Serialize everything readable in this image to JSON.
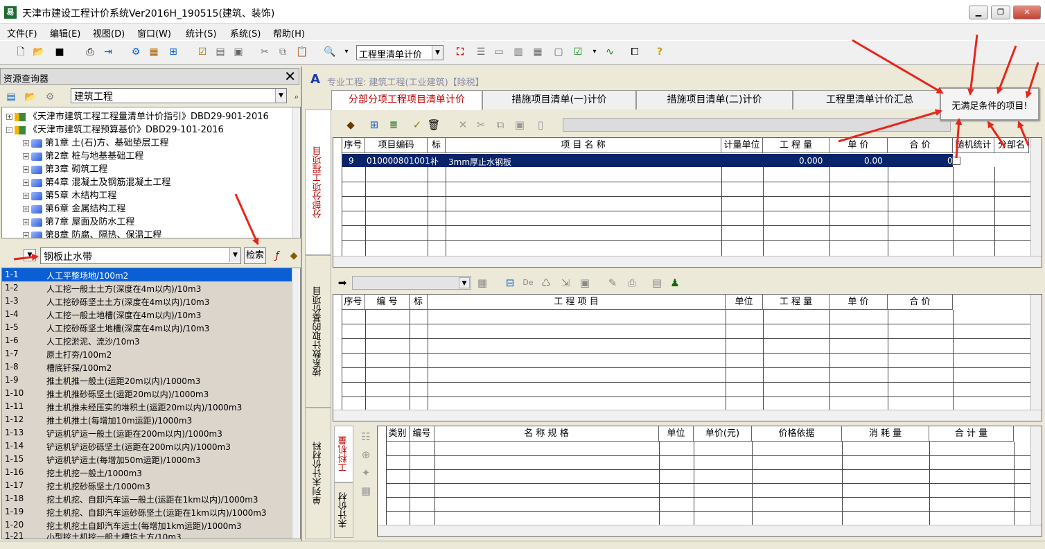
{
  "window": {
    "title": "天津市建设工程计价系统Ver2016H_190515(建筑、装饰)",
    "icon": "app-icon",
    "controls": [
      "minimize-icon",
      "restore-icon",
      "close-icon"
    ]
  },
  "menu": [
    "文件(F)",
    "编辑(E)",
    "视图(D)",
    "窗口(W)",
    "统计(S)",
    "系统(S)",
    "帮助(H)"
  ],
  "toolbar": {
    "view_select": "工程里清单计价",
    "icons": [
      "new-icon",
      "open-icon",
      "save-icon",
      "print-icon",
      "exit-icon",
      "calc-icon",
      "report-icon",
      "tree-icon",
      "check-icon",
      "template-icon",
      "export-icon",
      "cut-icon",
      "copy-icon",
      "paste-icon",
      "find-icon",
      "select-all-icon",
      "list-icon",
      "window-icon",
      "layout-icon",
      "chart-icon",
      "grid-icon",
      "help-icon"
    ]
  },
  "left_panel": {
    "title": "资源查询器",
    "library": "建筑工程",
    "tree": [
      {
        "label": "《天津市建筑工程工程量清单计价指引》DBD29-901-2016",
        "level": 0,
        "expand": "+",
        "icon": "book-icon"
      },
      {
        "label": "《天津市建筑工程预算基价》DBD29-101-2016",
        "level": 0,
        "expand": "-",
        "icon": "book-icon"
      },
      {
        "label": "第1章   土(石)方、基础垫层工程",
        "level": 1,
        "expand": "+",
        "icon": "chapter-icon"
      },
      {
        "label": "第2章   桩与地基基础工程",
        "level": 1,
        "expand": "+",
        "icon": "chapter-icon"
      },
      {
        "label": "第3章   砌筑工程",
        "level": 1,
        "expand": "+",
        "icon": "chapter-icon"
      },
      {
        "label": "第4章   混凝土及钢筋混凝土工程",
        "level": 1,
        "expand": "+",
        "icon": "chapter-icon"
      },
      {
        "label": "第5章   木结构工程",
        "level": 1,
        "expand": "+",
        "icon": "chapter-icon"
      },
      {
        "label": "第6章   金属结构工程",
        "level": 1,
        "expand": "+",
        "icon": "chapter-icon"
      },
      {
        "label": "第7章   屋面及防水工程",
        "level": 1,
        "expand": "+",
        "icon": "chapter-icon"
      },
      {
        "label": "第8章   防腐、隔热、保温工程",
        "level": 1,
        "expand": "+",
        "icon": "chapter-icon"
      }
    ],
    "search_value": "钢板止水带",
    "search_button": "检索",
    "quota_items": [
      {
        "code": "1-1",
        "name": "人工平整场地/100m2"
      },
      {
        "code": "1-2",
        "name": "人工挖一般土土方(深度在4m以内)/10m3"
      },
      {
        "code": "1-3",
        "name": "人工挖砂砾坚土土方(深度在4m以内)/10m3"
      },
      {
        "code": "1-4",
        "name": "人工挖一般土地槽(深度在4m以内)/10m3"
      },
      {
        "code": "1-5",
        "name": "人工挖砂砾坚土地槽(深度在4m以内)/10m3"
      },
      {
        "code": "1-6",
        "name": "人工挖淤泥、流沙/10m3"
      },
      {
        "code": "1-7",
        "name": "原土打夯/100m2"
      },
      {
        "code": "1-8",
        "name": "槽底钎探/100m2"
      },
      {
        "code": "1-9",
        "name": "推土机推一般土(运距20m以内)/1000m3"
      },
      {
        "code": "1-10",
        "name": "推土机推砂砾坚土(运距20m以内)/1000m3"
      },
      {
        "code": "1-11",
        "name": "推土机推未经压实的堆积土(运距20m以内)/1000m3"
      },
      {
        "code": "1-12",
        "name": "推土机推土(每增加10m运距)/1000m3"
      },
      {
        "code": "1-13",
        "name": "铲运机铲运一般土(运距在200m以内)/1000m3"
      },
      {
        "code": "1-14",
        "name": "铲运机铲运砂砾坚土(运距在200m以内)/1000m3"
      },
      {
        "code": "1-15",
        "name": "铲运机铲运土(每增加50m运距)/1000m3"
      },
      {
        "code": "1-16",
        "name": "挖土机挖一般土/1000m3"
      },
      {
        "code": "1-17",
        "name": "挖土机挖砂砾坚土/1000m3"
      },
      {
        "code": "1-18",
        "name": "挖土机挖、自卸汽车运一般土(运距在1km以内)/1000m3"
      },
      {
        "code": "1-19",
        "name": "挖土机挖、自卸汽车运砂砾坚土(运距在1km以内)/1000m3"
      },
      {
        "code": "1-20",
        "name": "挖土机挖土自卸汽车运土(每增加1km运距)/1000m3"
      },
      {
        "code": "1-21",
        "name": "小型挖土机挖一般土槽坑土方/10m3"
      }
    ]
  },
  "document": {
    "title": "专业工程: 建筑工程(工业建筑)【除税】",
    "tabs": [
      "分部分项工程项目清单计价",
      "措施项目清单(一)计价",
      "措施项目清单(二)计价",
      "工程里清单计价汇总"
    ],
    "vertical_tabs": [
      "分部分项工程项目",
      "按系数计取的基价项目",
      "单列未计价材料"
    ],
    "bottom_vtabs": [
      "工料机量",
      "未计价材"
    ],
    "grid1": {
      "headers": [
        "序号",
        "项目编码",
        "标",
        "项  目  名  称",
        "计量单位",
        "工 程 量",
        "单  价",
        "合  价",
        "随机统计",
        "分部名"
      ],
      "row": {
        "seq": "9",
        "code": "010000801001",
        "flag": "补",
        "name": "3mm厚止水钢板",
        "unit": "",
        "qty": "0.000",
        "price": "0.00",
        "total": "0"
      }
    },
    "grid2": {
      "headers": [
        "序号",
        "编  号",
        "标",
        "工   程   项   目",
        "单位",
        "工 程 量",
        "单  价",
        "合  价"
      ]
    },
    "grid3": {
      "headers": [
        "类别",
        "编号",
        "名   称   规   格",
        "单位",
        "单价(元)",
        "价格依据",
        "消 耗 量",
        "合 计 量"
      ]
    }
  },
  "popup": {
    "text": "无满足条件的项目!"
  },
  "annotation_color": "#e8251a"
}
